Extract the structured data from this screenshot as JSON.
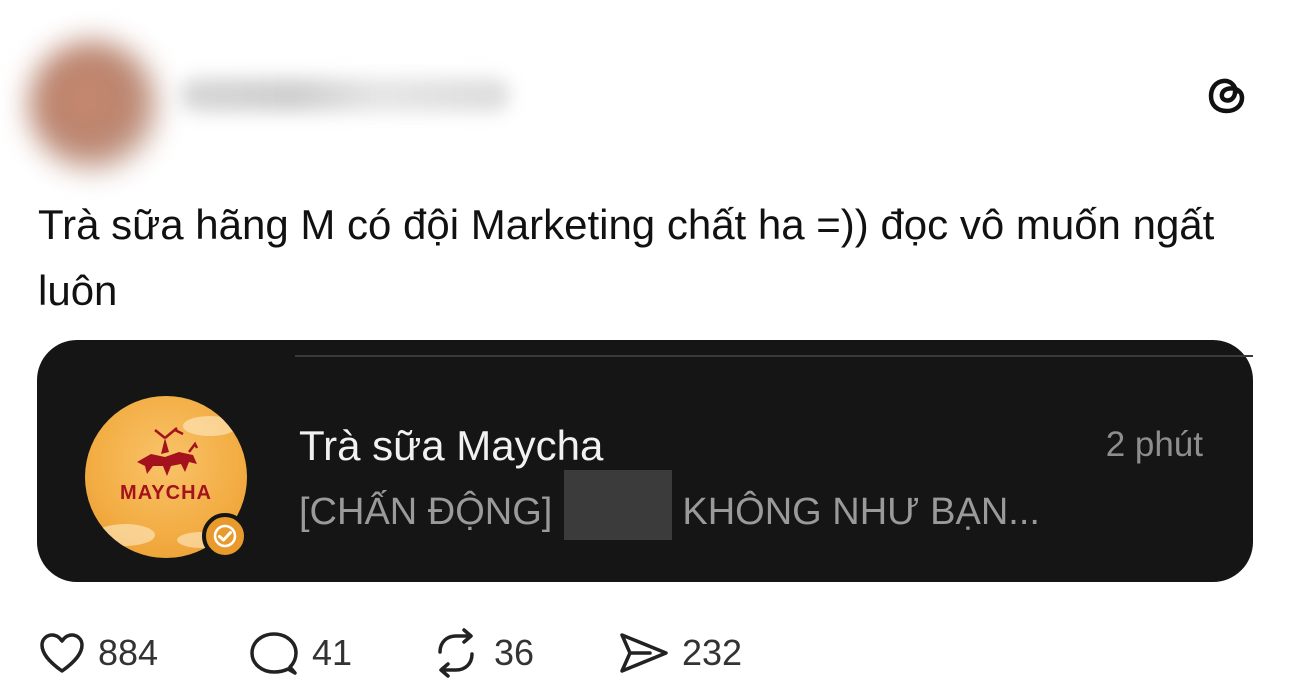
{
  "header": {
    "avatar_icon": "blurred-avatar",
    "username_blurred": true,
    "app_icon": "threads-logo-icon"
  },
  "post": {
    "text": "Trà sữa hãng M có đội Marketing chất ha =)) đọc vô muốn ngất luôn"
  },
  "notification_card": {
    "app_name": "Trà sữa Maycha",
    "time": "2 phút",
    "preview_prefix": "[CHẤN ĐỘNG]",
    "preview_suffix": "KHÔNG NHƯ BẠN...",
    "logo_text": "MAYCHA",
    "logo_color": "#f3ae45",
    "brand_red": "#a3121d",
    "badge_icon": "verified-check-icon"
  },
  "actions": {
    "likes": "884",
    "comments": "41",
    "reposts": "36",
    "shares": "232"
  }
}
